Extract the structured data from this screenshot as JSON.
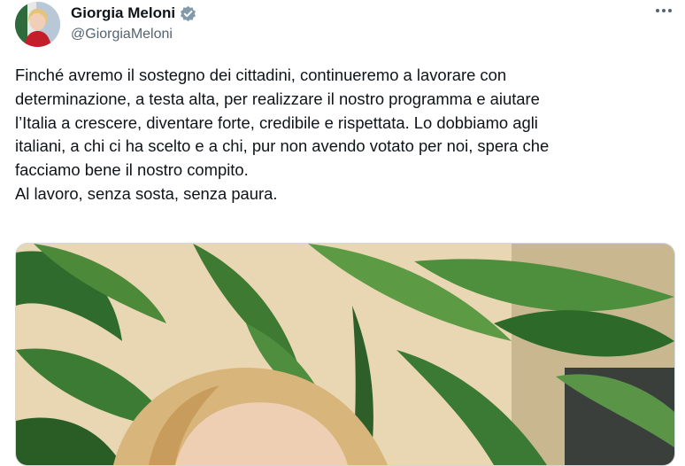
{
  "author": {
    "display_name": "Giorgia Meloni",
    "handle": "@GiorgiaMeloni",
    "verified_icon": "verified-badge-icon",
    "avatar_icon": "profile-avatar"
  },
  "menu": {
    "more_icon": "more-options-icon"
  },
  "tweet": {
    "lines": [
      "Finché avremo il sostegno dei cittadini, continueremo a lavorare con",
      "determinazione, a testa alta, per realizzare il nostro programma e aiutare",
      "l’Italia a crescere, diventare forte, credibile e rispettata. Lo dobbiamo agli",
      "italiani, a chi ci ha scelto e a chi, pur non avendo votato per noi, spera che",
      "facciamo bene il nostro compito.",
      "Al lavoro, senza sosta, senza paura."
    ]
  },
  "media": {
    "kind": "photo"
  },
  "colors": {
    "text": "#0f1419",
    "secondary": "#536471",
    "verified": "#829aab",
    "border": "#cfd9de"
  }
}
